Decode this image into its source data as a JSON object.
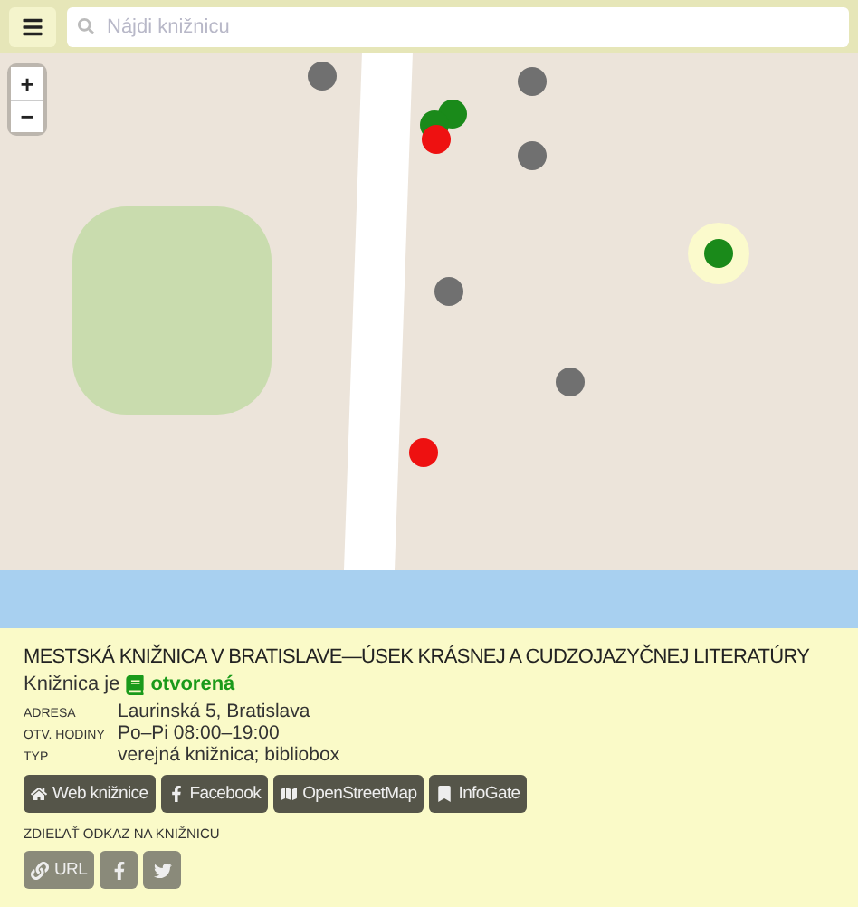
{
  "search": {
    "placeholder": "Nájdi knižnicu"
  },
  "zoom_controls": [
    "+",
    "−"
  ],
  "markers": [
    {
      "color": "#707070"
    },
    {
      "color": "#1a8a1a"
    },
    {
      "color": "#1a8a1a"
    },
    {
      "color": "#ee1111"
    },
    {
      "color": "#707070"
    },
    {
      "color": "#707070"
    },
    {
      "color": "#707070"
    },
    {
      "color": "#1a8a1a",
      "selected": true
    },
    {
      "color": "#707070"
    },
    {
      "color": "#ee1111"
    }
  ],
  "library": {
    "title": "MESTSKÁ KNIŽNICA V BRATISLAVE—ÚSEK KRÁSNEJ A CUDZOJAZYČNEJ LITERATÚRY",
    "status_label": "Knižnica je",
    "status": "otvorená",
    "open": true,
    "details": [
      {
        "label": "ADRESA",
        "value": "Laurinská 5, Bratislava"
      },
      {
        "label": "OTV. HODINY",
        "value": "Po–Pi 08:00–19:00"
      },
      {
        "label": "TYP",
        "value": "verejná knižnica; bibliobox"
      }
    ],
    "links": [
      {
        "kind": "home",
        "label": "Web knižnice"
      },
      {
        "kind": "facebook",
        "label": "Facebook"
      },
      {
        "kind": "map",
        "label": "OpenStreetMap"
      },
      {
        "kind": "bookmark",
        "label": "InfoGate"
      }
    ],
    "share_heading": "ZDIEĽAŤ ODKAZ NA KNIŽNICU",
    "share": [
      {
        "kind": "url",
        "label": "URL"
      },
      {
        "kind": "facebook"
      },
      {
        "kind": "twitter"
      }
    ]
  }
}
